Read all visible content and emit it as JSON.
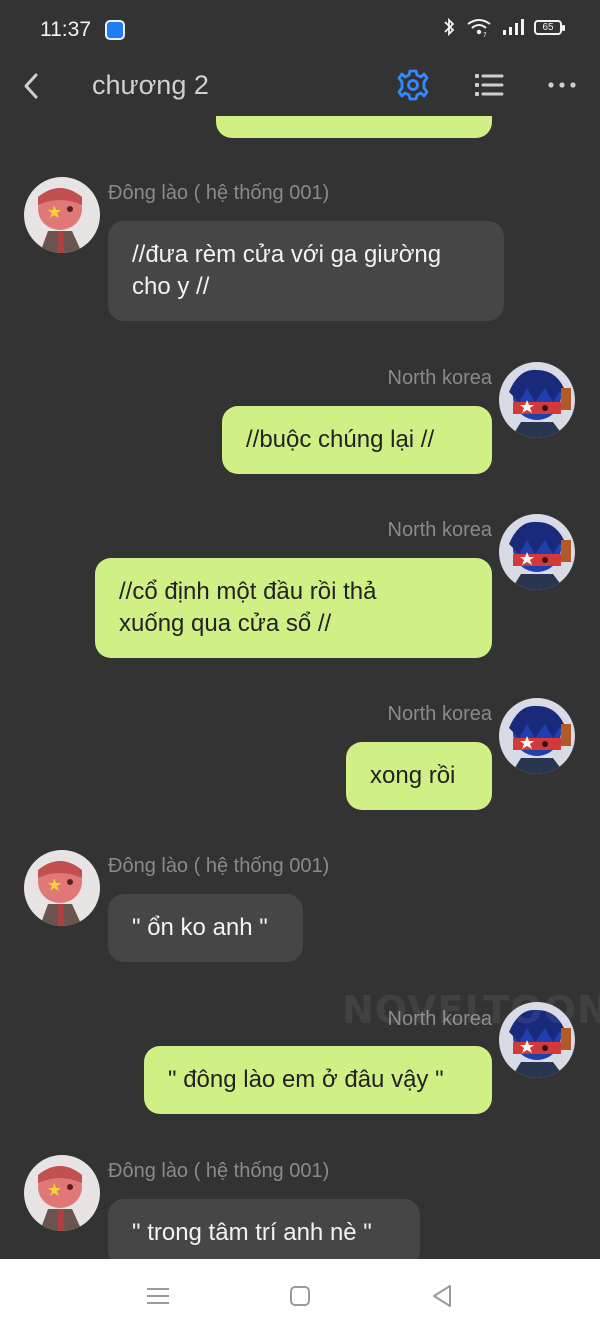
{
  "status_bar": {
    "time": "11:37",
    "battery": "65"
  },
  "app_bar": {
    "title": "chương 2"
  },
  "watermark": "NOVELTOON",
  "messages": [
    {
      "side": "left",
      "sender": "Đông lào ( hệ thống 001)",
      "text_lines": [
        "//đưa rèm cửa với ga giường",
        "cho y //"
      ]
    },
    {
      "side": "right",
      "sender": "North korea",
      "text_lines": [
        "//buộc chúng lại //"
      ]
    },
    {
      "side": "right",
      "sender": "North korea",
      "text_lines": [
        "//cổ định một đầu rồi thả",
        "xuống qua cửa sổ //"
      ]
    },
    {
      "side": "right",
      "sender": "North korea",
      "text_lines": [
        "xong rồi"
      ]
    },
    {
      "side": "left",
      "sender": "Đông lào ( hệ thống 001)",
      "text_lines": [
        "\" ổn ko anh \""
      ]
    },
    {
      "side": "right",
      "sender": "North korea",
      "text_lines": [
        "\" đông lào em ở đâu vậy \""
      ]
    },
    {
      "side": "left",
      "sender": "Đông lào ( hệ thống 001)",
      "text_lines": [
        "\" trong tâm trí anh nè \""
      ]
    }
  ],
  "colors": {
    "background": "#333333",
    "my_bubble": "#d0f085",
    "their_bubble": "#464646",
    "accent": "#2f8bff"
  },
  "icons": {
    "back": "chevron-left-icon",
    "settings": "gear-icon",
    "menu": "list-icon",
    "more": "more-dots-icon"
  }
}
